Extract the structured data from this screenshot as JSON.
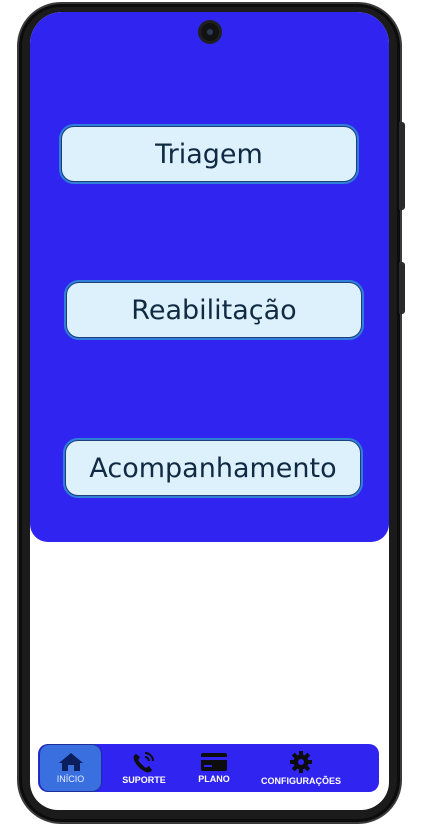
{
  "buttons": [
    {
      "label": "Triagem"
    },
    {
      "label": "Reabilitação"
    },
    {
      "label": "Acompanhamento"
    }
  ],
  "nav": [
    {
      "label": "INÍCIO",
      "icon": "home-icon",
      "active": true
    },
    {
      "label": "SUPORTE",
      "icon": "phone-call-icon"
    },
    {
      "label": "PLANO",
      "icon": "credit-card-icon"
    },
    {
      "label": "CONFIGURAÇÕES",
      "icon": "gear-icon"
    }
  ],
  "colors": {
    "primary": "#3024f0",
    "button_bg": "#dcf1fb",
    "button_text": "#102a43",
    "active_tab": "#3a6fe0"
  }
}
